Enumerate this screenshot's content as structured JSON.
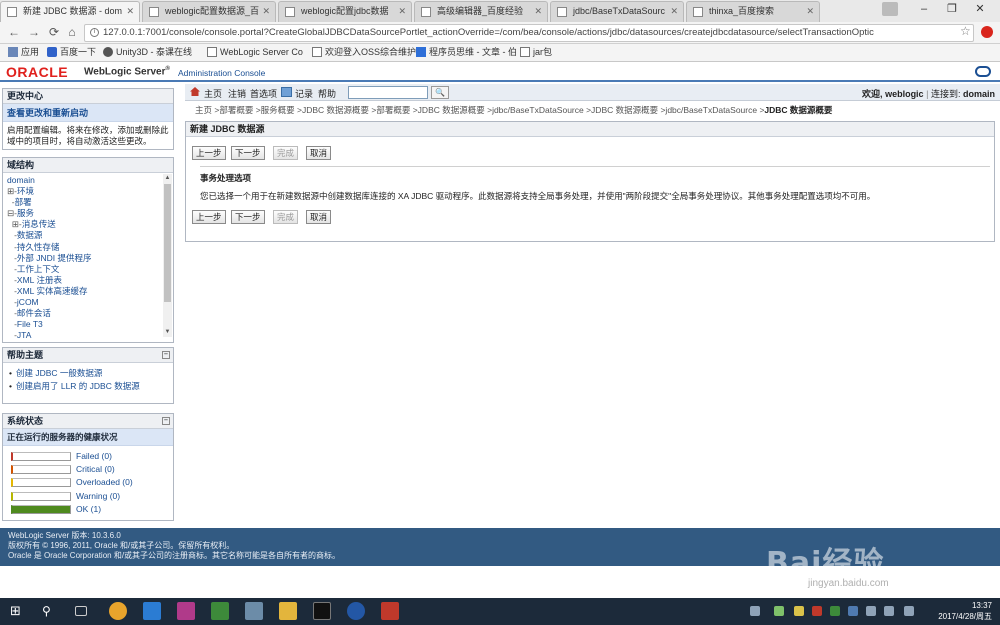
{
  "browser": {
    "tabs": [
      {
        "title": "新建 JDBC 数据源 - dom",
        "active": true
      },
      {
        "title": "weblogic配置数据源_百",
        "active": false
      },
      {
        "title": "weblogic配置jdbc数据",
        "active": false
      },
      {
        "title": "高级编辑器_百度经验",
        "active": false
      },
      {
        "title": "jdbc/BaseTxDataSourc",
        "active": false
      },
      {
        "title": "thinxa_百度搜索",
        "active": false
      }
    ],
    "url": "127.0.0.1:7001/console/console.portal?CreateGlobalJDBCDataSourcePortlet_actionOverride=/com/bea/console/actions/jdbc/datasources/createjdbcdatasource/selectTransactionOptic",
    "bookmarks": [
      "应用",
      "百度一下",
      "Unity3D - 泰课在线",
      "WebLogic Server Co",
      "欢迎登入OSS综合维护",
      "程序员思维 - 文章 - 伯",
      "jar包"
    ]
  },
  "header": {
    "oracle": "ORACLE",
    "product": "WebLogic Server",
    "reg": "®",
    "subtitle": "Administration Console"
  },
  "change_center": {
    "title": "更改中心",
    "link": "查看更改和重新启动",
    "text": "启用配置编辑。将来在修改，添加或删除此域中的项目时，将自动激活这些更改。"
  },
  "domain_structure": {
    "title": "域结构",
    "nodes": [
      {
        "prefix": "",
        "label": "domain"
      },
      {
        "prefix": "⊞-",
        "label": "环境"
      },
      {
        "prefix": "  -",
        "label": "部署"
      },
      {
        "prefix": "⊟-",
        "label": "服务"
      },
      {
        "prefix": "  ⊞-",
        "label": "消息传送"
      },
      {
        "prefix": "   -",
        "label": "数据源"
      },
      {
        "prefix": "   -",
        "label": "持久性存储"
      },
      {
        "prefix": "   -",
        "label": "外部 JNDI 提供程序"
      },
      {
        "prefix": "   -",
        "label": "工作上下文"
      },
      {
        "prefix": "   -",
        "label": "XML 注册表"
      },
      {
        "prefix": "   -",
        "label": "XML 实体高速缓存"
      },
      {
        "prefix": "   -",
        "label": "jCOM"
      },
      {
        "prefix": "   -",
        "label": "邮件会话"
      },
      {
        "prefix": "   -",
        "label": "File T3"
      },
      {
        "prefix": "   -",
        "label": "JTA"
      }
    ]
  },
  "help": {
    "title": "帮助主题",
    "items": [
      "创建 JDBC 一般数据源",
      "创建启用了 LLR 的 JDBC 数据源"
    ]
  },
  "system_status": {
    "title": "系统状态",
    "subtitle": "正在运行的服务器的健康状况",
    "rows": [
      {
        "label": "Failed (0)",
        "color": "#c0392b",
        "fraction": 0
      },
      {
        "label": "Critical (0)",
        "color": "#d35400",
        "fraction": 0
      },
      {
        "label": "Overloaded (0)",
        "color": "#e6b800",
        "fraction": 0
      },
      {
        "label": "Warning (0)",
        "color": "#b7b700",
        "fraction": 0
      },
      {
        "label": "OK (1)",
        "color": "#4f8a1e",
        "fraction": 1
      }
    ]
  },
  "toolbar": {
    "home": "主页",
    "logout": "注销",
    "prefs": "首选项",
    "record": "记录",
    "help": "帮助",
    "search_btn": "🔍",
    "welcome_label": "欢迎,",
    "user": "weblogic",
    "connected_label": "连接到:",
    "domain": "domain"
  },
  "breadcrumb": {
    "path": "主页 >部署概要 >服务概要 >JDBC 数据源概要 >部署概要 >JDBC 数据源概要 >jdbc/BaseTxDataSource >JDBC 数据源概要 >jdbc/BaseTxDataSource >",
    "current": "JDBC 数据源概要"
  },
  "content": {
    "title": "新建 JDBC 数据源",
    "buttons": {
      "back": "上一步",
      "next": "下一步",
      "finish": "完成",
      "cancel": "取消"
    },
    "section_title": "事务处理选项",
    "section_text": "您已选择一个用于在新建数据源中创建数据库连接的 XA JDBC 驱动程序。此数据源将支持全局事务处理，并使用\"两阶段提交\"全局事务处理协议。其他事务处理配置选项均不可用。"
  },
  "footer": {
    "line1": "WebLogic Server 版本: 10.3.6.0",
    "line2": "版权所有 © 1996, 2011, Oracle 和/或其子公司。保留所有权利。",
    "line3": "Oracle 是 Oracle Corporation 和/或其子公司的注册商标。其它名称可能是各自所有者的商标。"
  },
  "watermark": {
    "brand": "Bai经验",
    "site": "jingyan.baidu.com"
  },
  "taskbar": {
    "time": "13:37",
    "date": "2017/4/28/周五"
  }
}
